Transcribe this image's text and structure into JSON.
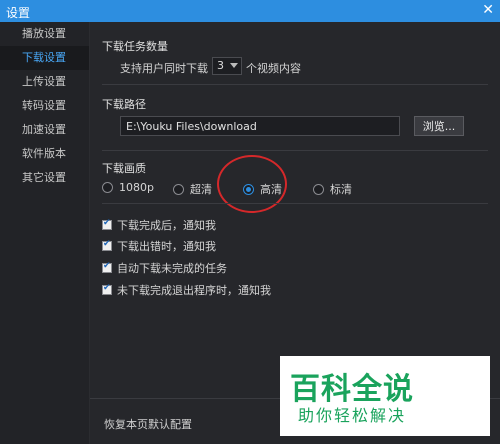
{
  "window": {
    "title": "设置",
    "close_glyph": "✕"
  },
  "sidebar": {
    "items": [
      {
        "label": "播放设置",
        "active": false
      },
      {
        "label": "下载设置",
        "active": true
      },
      {
        "label": "上传设置",
        "active": false
      },
      {
        "label": "转码设置",
        "active": false
      },
      {
        "label": "加速设置",
        "active": false
      },
      {
        "label": "软件版本",
        "active": false
      },
      {
        "label": "其它设置",
        "active": false
      }
    ]
  },
  "tasks": {
    "title": "下载任务数量",
    "prefix": "支持用户同时下载",
    "value": "3",
    "suffix": "个视频内容"
  },
  "path": {
    "title": "下载路径",
    "value": "E:\\Youku Files\\download",
    "browse_label": "浏览..."
  },
  "quality": {
    "title": "下载画质",
    "options": [
      {
        "label": "1080p",
        "selected": false
      },
      {
        "label": "超清",
        "selected": false
      },
      {
        "label": "高清",
        "selected": true
      },
      {
        "label": "标清",
        "selected": false
      }
    ]
  },
  "checkboxes": [
    {
      "label": "下载完成后，通知我",
      "checked": true
    },
    {
      "label": "下载出错时，通知我",
      "checked": true
    },
    {
      "label": "自动下载未完成的任务",
      "checked": true
    },
    {
      "label": "未下载完成退出程序时，通知我",
      "checked": true
    }
  ],
  "footer": {
    "restore_label": "恢复本页默认配置"
  },
  "watermark": {
    "logo": "百科全说",
    "sub": "助你轻松解决"
  },
  "colors": {
    "accent": "#2d8ee0",
    "highlight_circle": "#d5282a",
    "watermark": "#1aa35c"
  }
}
